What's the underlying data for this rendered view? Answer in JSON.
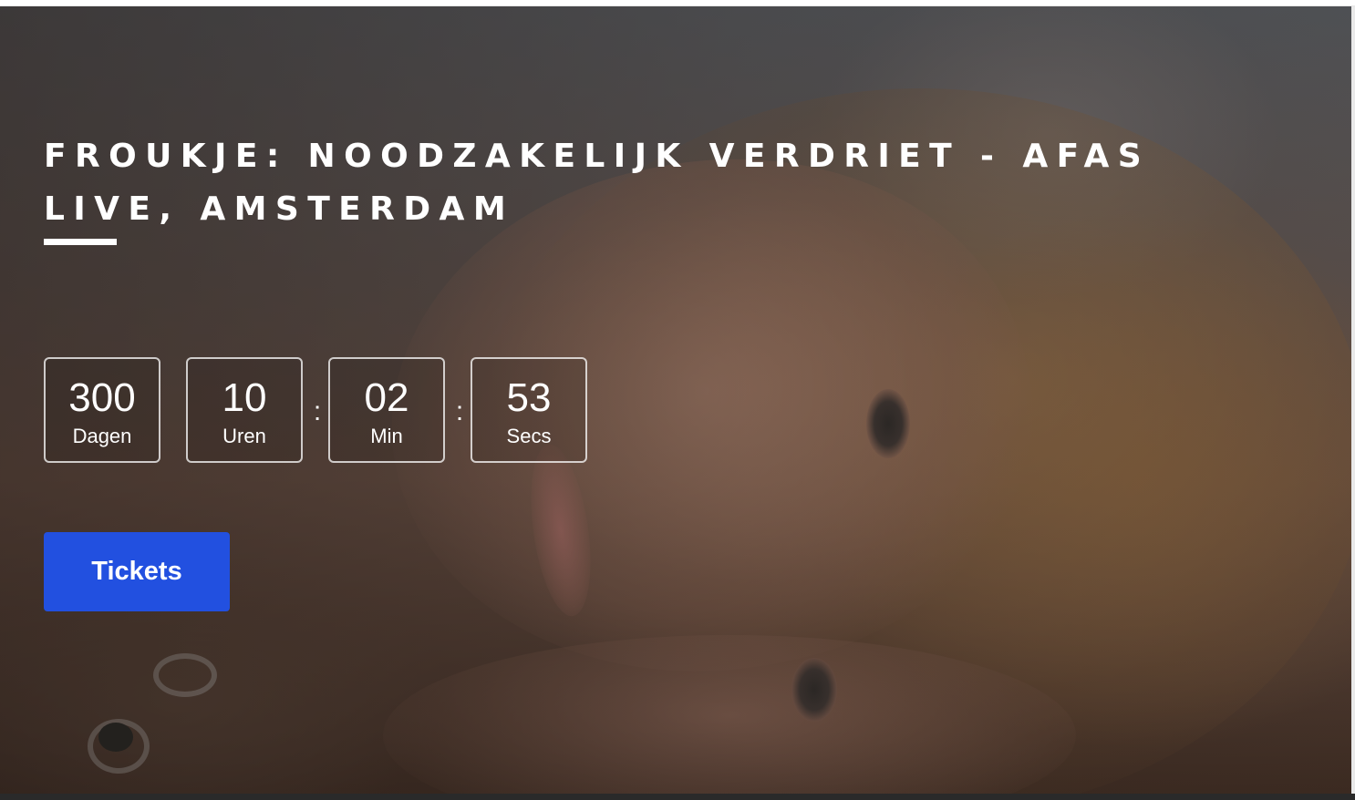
{
  "event": {
    "title": "FROUKJE: NOODZAKELIJK VERDRIET - AFAS LIVE, AMSTERDAM"
  },
  "countdown": {
    "separator": ":",
    "units": [
      {
        "value": "300",
        "label": "Dagen"
      },
      {
        "value": "10",
        "label": "Uren"
      },
      {
        "value": "02",
        "label": "Min"
      },
      {
        "value": "53",
        "label": "Secs"
      }
    ]
  },
  "cta": {
    "tickets_label": "Tickets",
    "color": "#2250e0"
  },
  "hero": {
    "image": "portrait-photo"
  }
}
